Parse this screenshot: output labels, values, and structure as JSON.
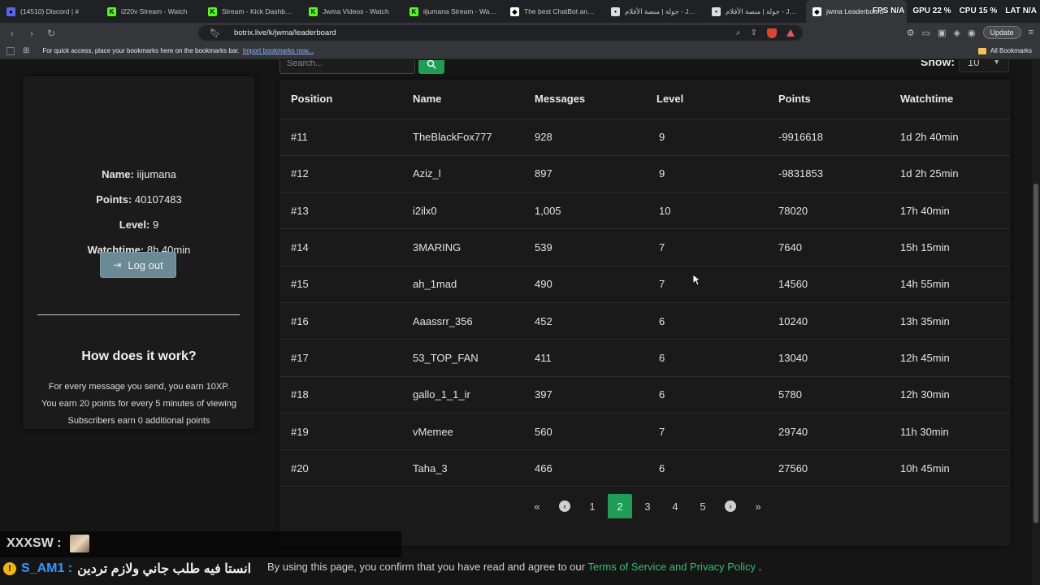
{
  "tabs": [
    {
      "title": "(14510) Discord | #",
      "color": "#5865f2",
      "glyph": "●"
    },
    {
      "title": "i220v Stream - Watch",
      "color": "#53fc18",
      "glyph": "K"
    },
    {
      "title": "Stream - Kick Dashboard",
      "color": "#53fc18",
      "glyph": "K"
    },
    {
      "title": "Jwma Videos - Watch",
      "color": "#53fc18",
      "glyph": "K"
    },
    {
      "title": "iijumana Stream - Watch",
      "color": "#53fc18",
      "glyph": "K"
    },
    {
      "title": "The best ChatBot and Wi",
      "color": "#ffffff",
      "glyph": "◆"
    },
    {
      "title": "جولة | منصة الأفلام - Jawlah",
      "color": "#dddddd",
      "glyph": "•"
    },
    {
      "title": "جولة | منصة الأفلام - Jawlah",
      "color": "#dddddd",
      "glyph": "•"
    },
    {
      "title": "jwma Leaderboard",
      "color": "#ffffff",
      "glyph": "◆",
      "active": true
    }
  ],
  "perf": {
    "fps_label": "FPS",
    "fps": "N/A",
    "gpu_label": "GPU",
    "gpu": "22 %",
    "cpu_label": "CPU",
    "cpu": "15 %",
    "lat_label": "LAT",
    "lat": "N/A"
  },
  "address": {
    "url": "botrix.live/k/jwma/leaderboard",
    "update_label": "Update"
  },
  "bookmarks": {
    "hint": "For quick access, place your bookmarks here on the bookmarks bar.",
    "import_link": "Import bookmarks now...",
    "all": "All Bookmarks"
  },
  "profile": {
    "name_label": "Name:",
    "name": "iijumana",
    "points_label": "Points:",
    "points": "40107483",
    "level_label": "Level:",
    "level": "9",
    "watch_label": "Watchtime:",
    "watch": "8h 40min",
    "logout_label": "Log out"
  },
  "how": {
    "title": "How does it work?",
    "lines": [
      "For every message you send, you earn 10XP.",
      "You earn 20 points for every 5 minutes of viewing",
      "Subscribers earn 0 additional points"
    ]
  },
  "search": {
    "placeholder": "Search...",
    "show_label": "Show:",
    "show_value": "10"
  },
  "table": {
    "headers": [
      "Position",
      "Name",
      "Messages",
      "Level",
      "Points",
      "Watchtime"
    ],
    "rows": [
      [
        "#11",
        "TheBlackFox777",
        "928",
        "9",
        "-9916618",
        "1d 2h 40min"
      ],
      [
        "#12",
        "Aziz_l",
        "897",
        "9",
        "-9831853",
        "1d 2h 25min"
      ],
      [
        "#13",
        "i2ilx0",
        "1,005",
        "10",
        "78020",
        "17h 40min"
      ],
      [
        "#14",
        "3MARING",
        "539",
        "7",
        "7640",
        "15h 15min"
      ],
      [
        "#15",
        "ah_1mad",
        "490",
        "7",
        "14560",
        "14h 55min"
      ],
      [
        "#16",
        "Aaassrr_356",
        "452",
        "6",
        "10240",
        "13h 35min"
      ],
      [
        "#17",
        "53_TOP_FAN",
        "411",
        "6",
        "13040",
        "12h 45min"
      ],
      [
        "#18",
        "gallo_1_1_ir",
        "397",
        "6",
        "5780",
        "12h 30min"
      ],
      [
        "#19",
        "vMemee",
        "560",
        "7",
        "29740",
        "11h 30min"
      ],
      [
        "#20",
        "Taha_3",
        "466",
        "6",
        "27560",
        "10h 45min"
      ]
    ]
  },
  "pagination": {
    "first": "«",
    "prev": "‹",
    "pages": [
      "1",
      "2",
      "3",
      "4",
      "5"
    ],
    "active": "2",
    "next": "›",
    "last": "»"
  },
  "footer": {
    "text": "By using this page, you confirm that you have read and agree to our ",
    "link": "Terms of Service and Privacy Policy",
    "end": " ."
  },
  "chat": {
    "line1_user": "XXXSW :",
    "line2_badge": "!",
    "line2_user": "S_AM1 :",
    "line2_msg": "انستا فيه طلب جاني ولازم تردين"
  }
}
